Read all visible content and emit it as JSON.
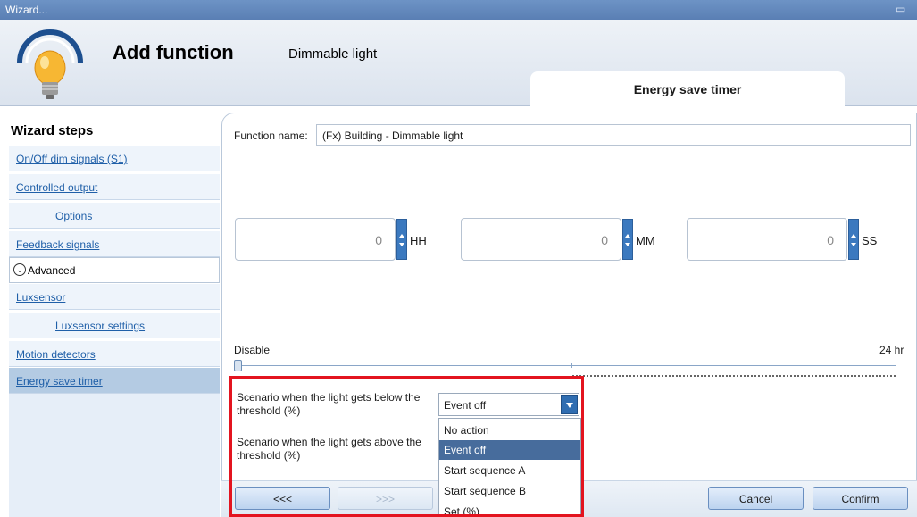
{
  "window": {
    "title": "Wizard...",
    "restore_icon": "restore-icon"
  },
  "header": {
    "title": "Add function",
    "subtitle": "Dimmable light",
    "logo_icon": "light-bulb-icon",
    "tab_label": "Energy save timer"
  },
  "sidebar": {
    "title": "Wizard steps",
    "items": [
      {
        "label": "On/Off dim signals (S1)"
      },
      {
        "label": "Controlled output"
      },
      {
        "label": "Options"
      },
      {
        "label": "Feedback signals"
      },
      {
        "label": "Advanced"
      },
      {
        "label": "Luxsensor"
      },
      {
        "label": "Luxsensor settings"
      },
      {
        "label": "Motion detectors"
      },
      {
        "label": "Energy save timer"
      }
    ]
  },
  "form": {
    "function_name_label": "Function name:",
    "function_name_value": "(Fx) Building - Dimmable light",
    "time": [
      {
        "value": "0",
        "unit": "HH"
      },
      {
        "value": "0",
        "unit": "MM"
      },
      {
        "value": "0",
        "unit": "SS"
      }
    ],
    "slider": {
      "min_label": "Disable",
      "max_label": "24 hr",
      "value": 0
    },
    "scenario_below_label": "Scenario when the light gets below the threshold (%)",
    "scenario_above_label": "Scenario when the light gets above the threshold (%)",
    "scenario_below_value": "Event off",
    "dropdown_options": [
      "No action",
      "Event off",
      "Start sequence A",
      "Start sequence B",
      "Set (%)"
    ],
    "dropdown_selected_index": 1
  },
  "buttons": {
    "back": "<<<",
    "next": ">>>",
    "cancel": "Cancel",
    "confirm": "Confirm"
  },
  "colors": {
    "titlebar": "#5a7fb4",
    "selected_step": "#b4cbe3",
    "dropdown_selected": "#476c9c",
    "highlight_frame": "#e3141f",
    "link": "#1f5fa8"
  }
}
